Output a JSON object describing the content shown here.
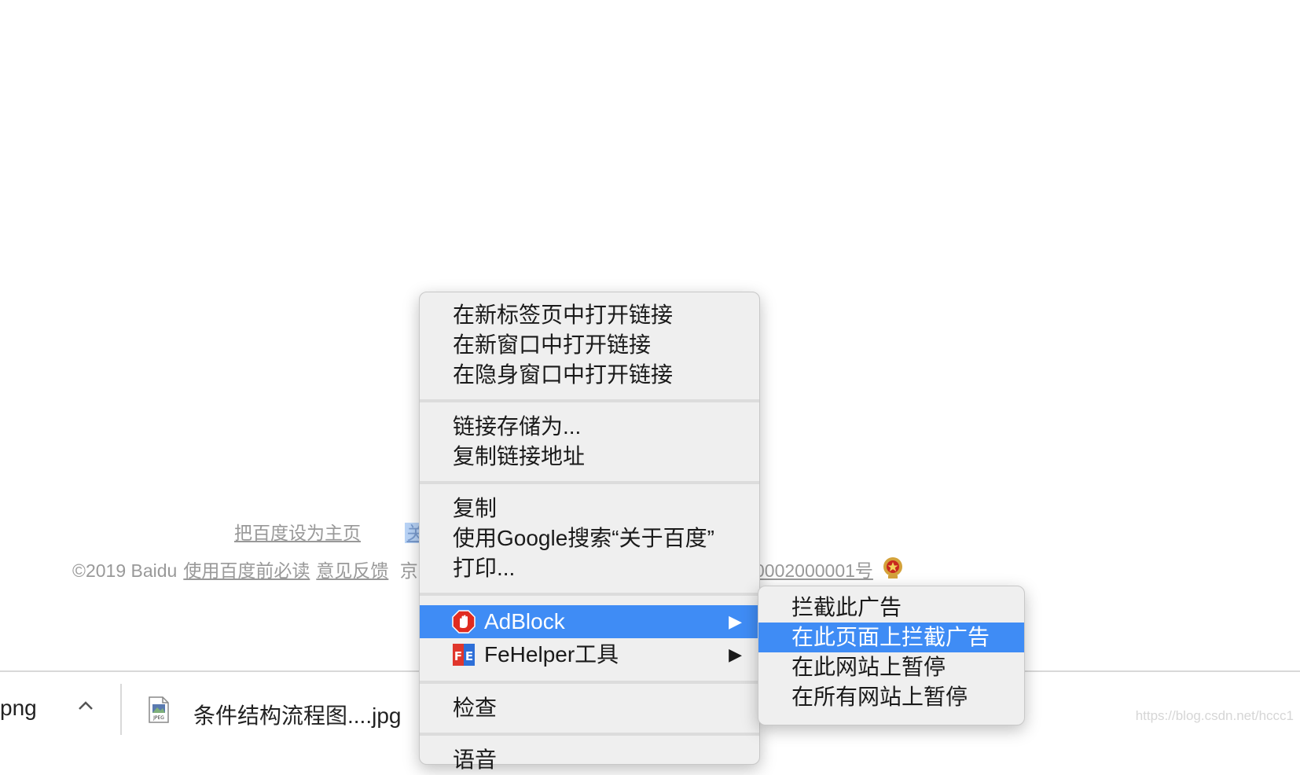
{
  "footer": {
    "set_homepage": "把百度设为主页",
    "about_selected": "关",
    "copyright_prefix": "©2019 Baidu",
    "must_read": "使用百度前必读",
    "feedback": "意见反馈",
    "icp_cut_start": "京",
    "icp_number": "0002000001号"
  },
  "context_menu": {
    "group1": [
      "在新标签页中打开链接",
      "在新窗口中打开链接",
      "在隐身窗口中打开链接"
    ],
    "group2": [
      "链接存储为...",
      "复制链接地址"
    ],
    "group3": [
      "复制",
      "使用Google搜索“关于百度”",
      "打印..."
    ],
    "extensions": [
      {
        "label": "AdBlock",
        "icon": "adblock-hand-icon",
        "arrow": "▶",
        "highlighted": true
      },
      {
        "label": "FeHelper工具",
        "icon": "fehelper-icon",
        "arrow": "▶",
        "highlighted": false
      }
    ],
    "inspect": "检查",
    "cut_off_next": "语音"
  },
  "adblock_submenu": {
    "items": [
      "拦截此广告",
      "在此页面上拦截广告",
      "在此网站上暂停",
      "在所有网站上暂停"
    ],
    "highlighted_index": 1
  },
  "download_bar": {
    "item1_tail": "png",
    "item2_name": "条件结构流程图....jpg",
    "file_type": "JPEG"
  },
  "watermark": "https://blog.csdn.net/hccc1",
  "colors": {
    "highlight": "#3f8cf5",
    "menu_bg": "#efefef",
    "adblock_red": "#e02b20",
    "link_gray": "#999999"
  }
}
